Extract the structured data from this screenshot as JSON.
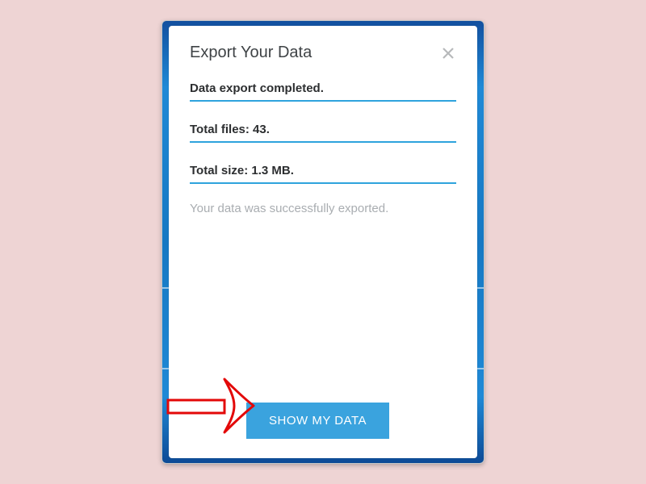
{
  "dialog": {
    "title": "Export Your Data",
    "status": "Data export completed.",
    "total_files": "Total files: 43.",
    "total_size": "Total size: 1.3 MB.",
    "success_msg": "Your data was successfully exported.",
    "action_label": "SHOW MY DATA"
  },
  "colors": {
    "accent": "#2ea3dd",
    "button": "#3aa3de",
    "page_bg": "#eed4d4",
    "annotation": "#e30808"
  }
}
